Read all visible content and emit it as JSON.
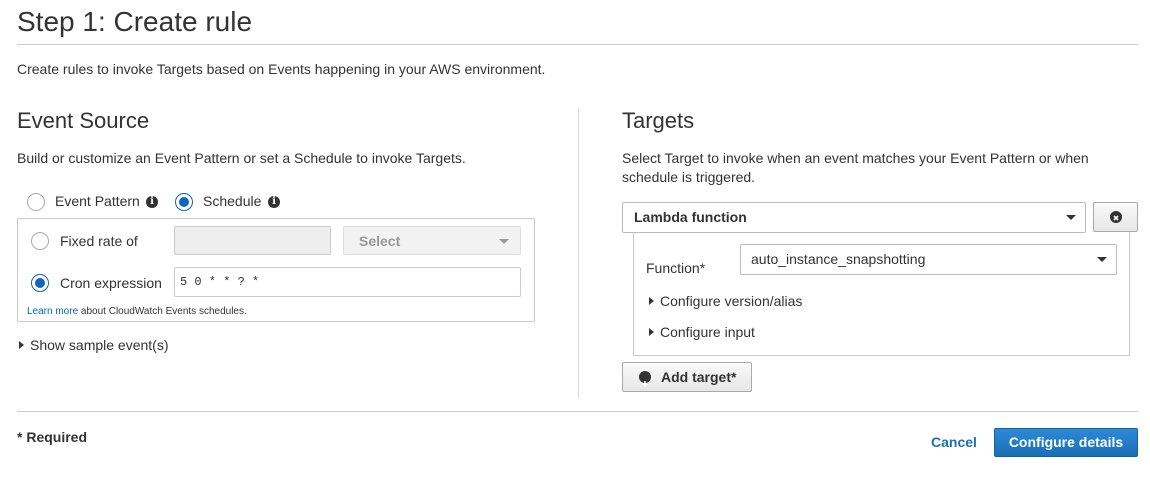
{
  "page": {
    "title": "Step 1: Create rule",
    "intro": "Create rules to invoke Targets based on Events happening in your AWS environment."
  },
  "event_source": {
    "heading": "Event Source",
    "description": "Build or customize an Event Pattern or set a Schedule to invoke Targets.",
    "mode_options": [
      {
        "label": "Event Pattern",
        "selected": false
      },
      {
        "label": "Schedule",
        "selected": true
      }
    ],
    "schedule": {
      "fixed_rate_label": "Fixed rate of",
      "fixed_rate_value": "",
      "unit_select_label": "Select",
      "cron_label": "Cron expression",
      "cron_value": "5 0 * * ? *",
      "selected": "cron",
      "learn_more_link": "Learn more",
      "learn_more_text": "about CloudWatch Events schedules."
    },
    "show_sample": "Show sample event(s)"
  },
  "targets": {
    "heading": "Targets",
    "description_line1": "Select Target to invoke when an event matches your Event Pattern or when",
    "description_line2": "schedule is triggered.",
    "target_type": "Lambda function",
    "function_label": "Function*",
    "function_value": "auto_instance_snapshotting",
    "configure_version": "Configure version/alias",
    "configure_input": "Configure input",
    "add_target": "Add target*"
  },
  "footer": {
    "required_note": "* Required",
    "cancel": "Cancel",
    "configure_details": "Configure details"
  },
  "colors": {
    "accent": "#1166bb",
    "primary_button": "#1b6fb8",
    "link": "#0066bb"
  }
}
